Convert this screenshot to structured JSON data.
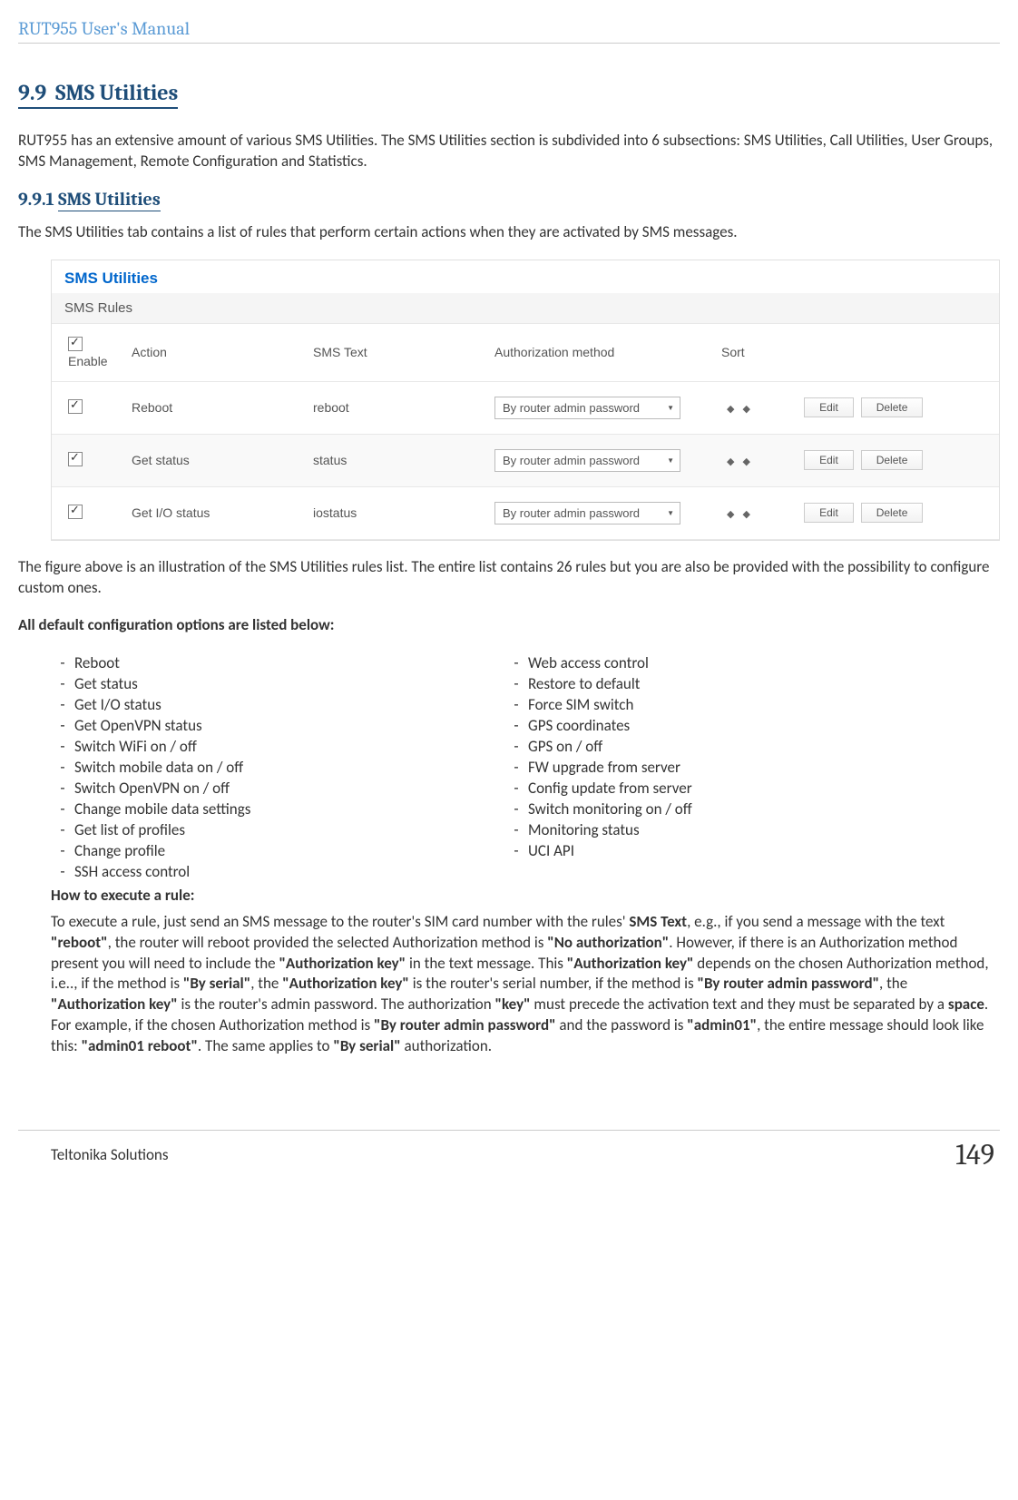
{
  "doc_header": "RUT955 User's Manual",
  "section": {
    "number": "9.9",
    "title": "SMS Utilities",
    "intro": "RUT955 has an extensive amount of various SMS Utilities. The SMS Utilities section is subdivided into 6 subsections: SMS Utilities, Call Utilities, User Groups, SMS Management, Remote Configuration and Statistics."
  },
  "subsection": {
    "number": "9.9.1",
    "title": "SMS Utilities",
    "intro": "The SMS Utilities tab contains a list of rules that perform certain actions when they are activated by SMS messages."
  },
  "screenshot": {
    "title": "SMS Utilities",
    "subtitle": "SMS Rules",
    "headers": {
      "enable": "Enable",
      "action": "Action",
      "sms_text": "SMS Text",
      "auth": "Authorization method",
      "sort": "Sort"
    },
    "rows": [
      {
        "action": "Reboot",
        "sms_text": "reboot",
        "auth": "By router admin password"
      },
      {
        "action": "Get status",
        "sms_text": "status",
        "auth": "By router admin password"
      },
      {
        "action": "Get I/O status",
        "sms_text": "iostatus",
        "auth": "By router admin password"
      }
    ],
    "edit_btn": "Edit",
    "delete_btn": "Delete"
  },
  "after_figure": "The figure above is an illustration of the SMS Utilities rules list. The entire list contains 26 rules but you are also be provided with the possibility to configure custom ones.",
  "options_heading": "All default configuration options are listed below:",
  "options_left": [
    "Reboot",
    "Get status",
    "Get I/O status",
    "Get OpenVPN status",
    "Switch WiFi on / off",
    "Switch mobile data on / off",
    "Switch OpenVPN on / off",
    "Change mobile data settings",
    "Get list of profiles",
    "Change profile",
    "SSH access control"
  ],
  "options_right": [
    "Web access control",
    "Restore to default",
    "Force SIM switch",
    "GPS coordinates",
    "GPS on / off",
    "FW upgrade from server",
    "Config update from server",
    "Switch monitoring on / off",
    "Monitoring status",
    "UCI API"
  ],
  "execute_heading": "How to execute a rule:",
  "execute": {
    "p1": "To execute a rule, just send an SMS message to the router's SIM card number with the rules' ",
    "b1": "SMS Text",
    "p2": ", e.g., if you send a message with the text ",
    "b2": "\"reboot\"",
    "p3": ", the router will reboot provided the selected Authorization method is ",
    "b3": "\"No authorization\"",
    "p4": ". However, if there is an Authorization method present you will need to include the ",
    "b4": "\"Authorization key\"",
    "p5": " in the text message. This ",
    "b5": "\"Authorization key\"",
    "p6": " depends on  the chosen Authorization method, i.e.., if the method is ",
    "b6": "\"By serial\"",
    "p7": ", the ",
    "b7": "\"Authorization key\"",
    "p8": " is the router's serial number, if the method is ",
    "b8": "\"By router admin password\"",
    "p9": ", the ",
    "b9": "\"Authorization key\"",
    "p10": " is the router's admin password. The authorization ",
    "b10": "\"key\"",
    "p11": " must precede the activation text and they must be separated by a ",
    "b11": "space",
    "p12": ". For example, if the chosen Authorization method is ",
    "b12": "\"By router admin password\"",
    "p13": " and the password is ",
    "b13": "\"admin01\"",
    "p14": ", the entire message should look like this: ",
    "b14": "\"admin01 reboot\"",
    "p15": ". The same applies to ",
    "b15": "\"By serial\"",
    "p16": " authorization."
  },
  "footer": {
    "left": "Teltonika Solutions",
    "page": "149"
  }
}
